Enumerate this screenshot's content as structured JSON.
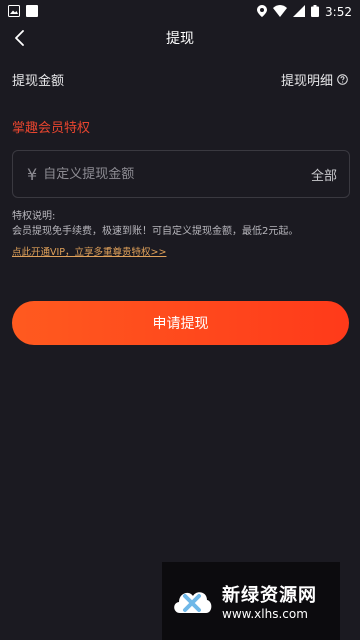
{
  "status_bar": {
    "time": "3:52"
  },
  "nav": {
    "title": "提现"
  },
  "header_row": {
    "left_label": "提现金额",
    "right_label": "提现明细"
  },
  "vip_section": {
    "title": "掌趣会员特权"
  },
  "amount_field": {
    "currency_symbol": "¥",
    "placeholder": "自定义提现金额",
    "value": "",
    "all_label": "全部"
  },
  "privilege": {
    "label": "特权说明:",
    "description": "会员提现免手续费，极速到账！可自定义提现金额，最低2元起。",
    "link_text": "点此开通VIP，立享多重尊贵特权>>"
  },
  "apply_button": {
    "label": "申请提现"
  },
  "watermark": {
    "title": "新绿资源网",
    "url": "www.xlhs.com"
  },
  "colors": {
    "background": "#1b1a21",
    "accent_red": "#e8452f",
    "link_orange": "#e0a15a",
    "button_gradient_start": "#ff5a1f",
    "button_gradient_end": "#ff3a1a"
  }
}
